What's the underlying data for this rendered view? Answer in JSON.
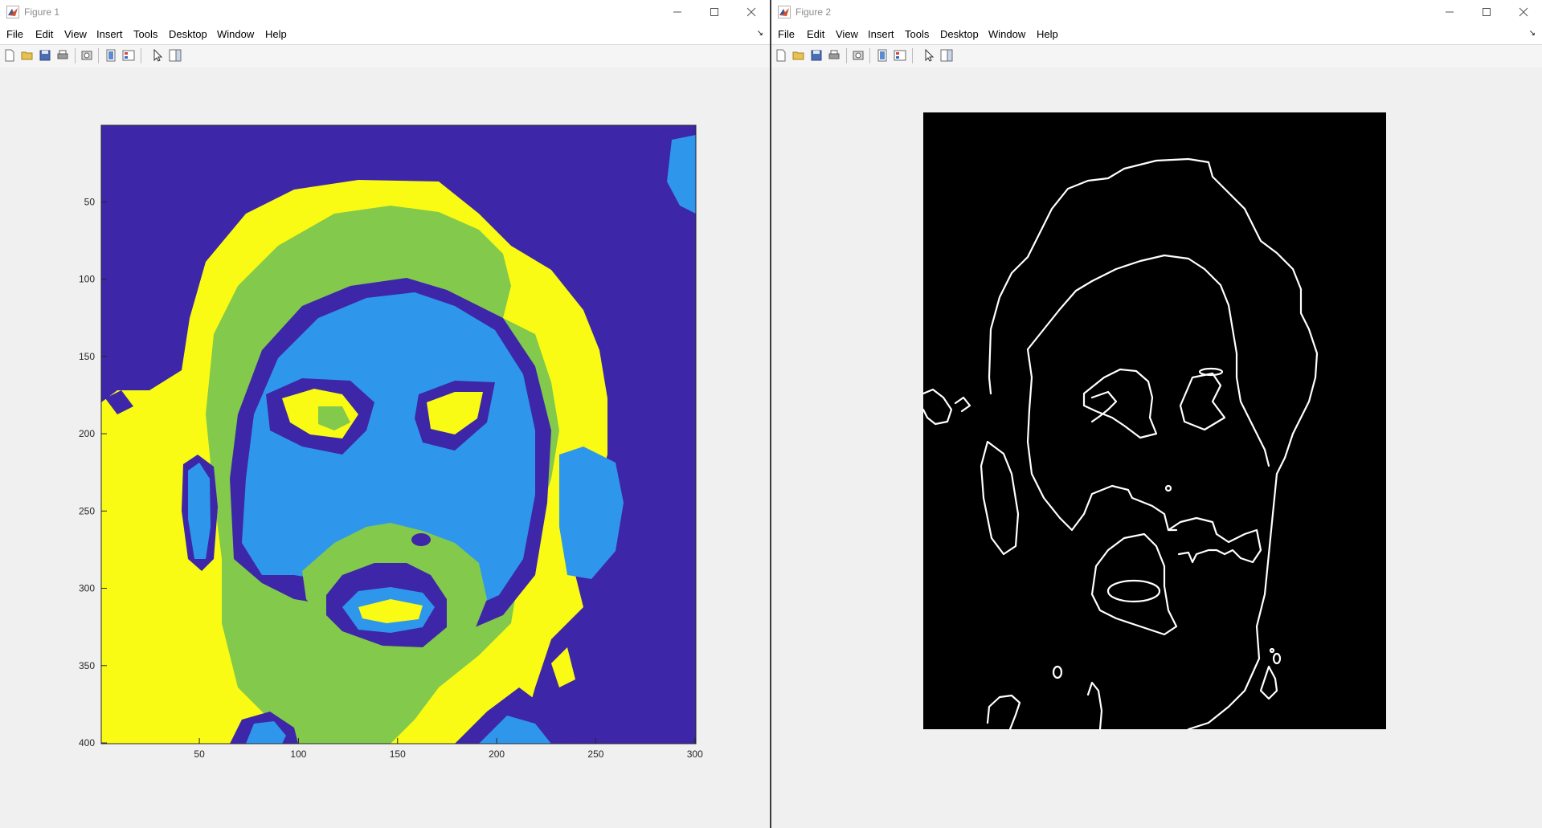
{
  "figures": [
    {
      "title": "Figure 1",
      "menu": [
        "File",
        "Edit",
        "View",
        "Insert",
        "Tools",
        "Desktop",
        "Window",
        "Help"
      ],
      "toolbar": [
        "new-figure-icon",
        "open-file-icon",
        "save-icon",
        "print-icon",
        "print-preview-icon",
        "link-plot-icon",
        "insert-legend-icon",
        "edit-plot-icon",
        "property-editor-icon"
      ],
      "window_controls": [
        "minimize-icon",
        "maximize-icon",
        "close-icon"
      ]
    },
    {
      "title": "Figure 2",
      "menu": [
        "File",
        "Edit",
        "View",
        "Insert",
        "Tools",
        "Desktop",
        "Window",
        "Help"
      ],
      "toolbar": [
        "new-figure-icon",
        "open-file-icon",
        "save-icon",
        "print-icon",
        "print-preview-icon",
        "link-plot-icon",
        "insert-legend-icon",
        "edit-plot-icon",
        "property-editor-icon"
      ],
      "window_controls": [
        "minimize-icon",
        "maximize-icon",
        "close-icon"
      ]
    }
  ],
  "chart_data": [
    {
      "type": "heatmap",
      "image": "k-means segmented face image, 4 clusters",
      "x_ticks": [
        50,
        100,
        150,
        200,
        250,
        300
      ],
      "y_ticks": [
        50,
        100,
        150,
        200,
        250,
        300,
        350,
        400
      ],
      "xlim": [
        0.5,
        300.5
      ],
      "ylim": [
        0.5,
        400.5
      ],
      "y_direction": "reverse",
      "colormap": [
        "#3e26a8",
        "#2e97ec",
        "#82c94c",
        "#f9fb14"
      ]
    },
    {
      "type": "heatmap",
      "image": "binary edge map (white edges on black)",
      "axis": "off",
      "colormap": [
        "#000000",
        "#ffffff"
      ]
    }
  ]
}
